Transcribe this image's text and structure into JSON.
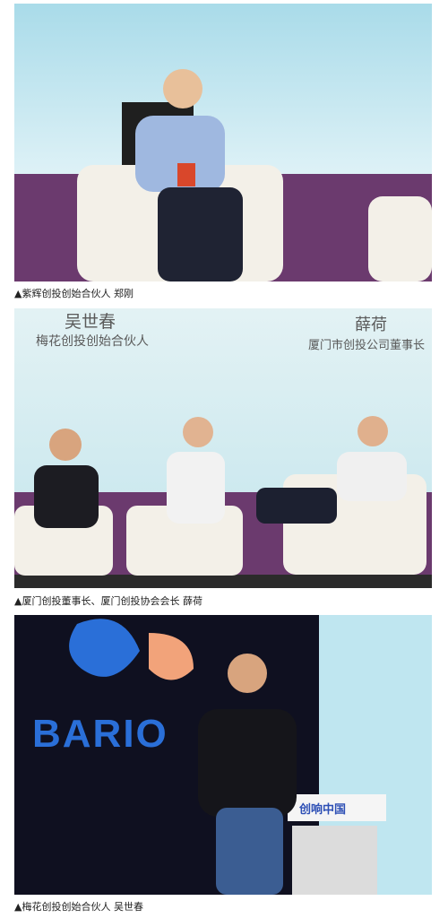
{
  "captions": {
    "photo1": "▲紫辉创投创始合伙人 郑刚",
    "photo2": "▲厦门创投董事长、厦门创投协会会长 薛荷",
    "photo3": "▲梅花创投创始合伙人  吴世春"
  },
  "photo2_signs": {
    "left_name": "吴世春",
    "left_title": "梅花创投创始合伙人",
    "right_name": "薛荷",
    "right_title": "厦门市创投公司董事长"
  },
  "photo3_stage": {
    "brand_text": "BARIO",
    "podium_logo_text": "创响中国"
  },
  "colors": {
    "stage_purple": "#6b3a6e",
    "stage_blue": "#bfe6f0",
    "brand_blue": "#2a6fd8"
  }
}
